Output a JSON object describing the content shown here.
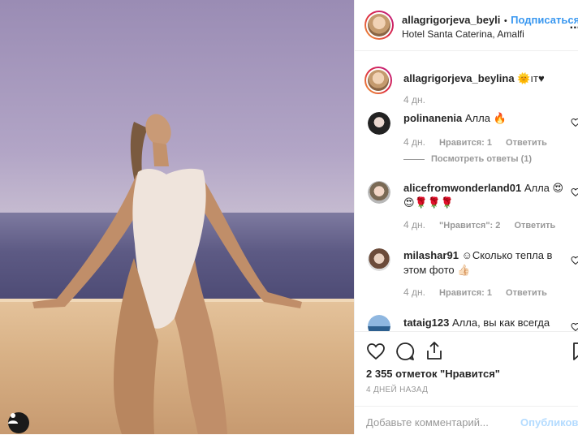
{
  "post": {
    "username": "allagrigorjeva_beyli",
    "separator": "•",
    "follow_label": "Подписаться",
    "location": "Hotel Santa Caterina, Amalfi",
    "more_label": "..."
  },
  "caption": {
    "username": "allagrigorjeva_beylina",
    "text": "🌞ıт♥",
    "time": "4 дн."
  },
  "comments": [
    {
      "username": "polinanenia",
      "text": "Алла 🔥",
      "time": "4 дн.",
      "likes": "Нравится: 1",
      "reply": "Ответить",
      "view_replies": "Посмотреть ответы (1)"
    },
    {
      "username": "alicefromwonderland01",
      "text": "Алла 😍",
      "line2": "😍🌹🌹🌹",
      "time": "4 дн.",
      "likes": "\"Нравится\": 2",
      "reply": "Ответить"
    },
    {
      "username": "milashar91",
      "text": "☺Сколько тепла в",
      "line2": "этом фото 👍🏻",
      "time": "4 дн.",
      "likes": "Нравится: 1",
      "reply": "Ответить"
    },
    {
      "username": "tataig123",
      "text": "Алла, вы как всегда"
    }
  ],
  "stats": {
    "likes_text": "2 355 отметок \"Нравится\"",
    "date_text": "4 ДНЕЙ НАЗАД"
  },
  "composer": {
    "placeholder": "Добавьте комментарий...",
    "post_label": "Опубликовать"
  },
  "icons": [
    "heart-icon",
    "comment-icon",
    "share-icon",
    "bookmark-icon",
    "user-tag-icon",
    "more-icon"
  ]
}
